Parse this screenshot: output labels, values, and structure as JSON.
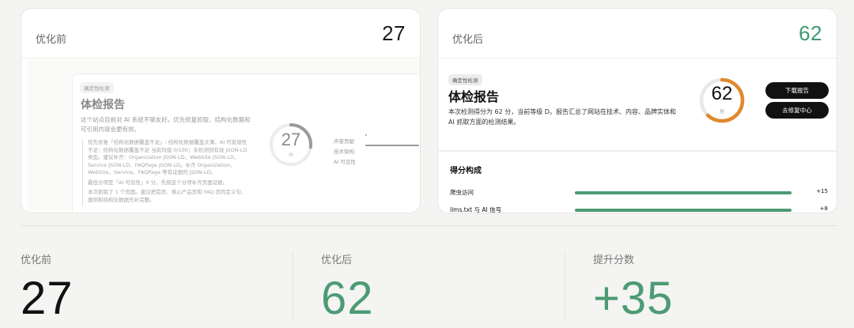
{
  "before_card": {
    "label": "优化前",
    "score": "27",
    "preview": {
      "badge": "确定性检测",
      "title": "体检报告",
      "description": "这个站点目前对 AI 系统不够友好。优先修复抓取、结构化数据和可引用内容会更有效。",
      "notes": [
        "优先修复「结构化数据覆盖不足」: 结构化数据覆盖太薄，AI 可发现性不足：结构化数据覆盖不足 当前均值 0/100；未检测到有效 JSON-LD 类型。建议补齐：Organization JSON-LD、WebSite JSON-LD、Service JSON-LD、FAQPage JSON-LD。补齐 Organization、WebSite、Service、FAQPage 等有证据的 JSON-LD。",
        "最低分项是「AI 可见性」0 分，先按这个分项补齐页面证据。",
        "本次抓取了 1 个页面。建议把首页、核心产品页和 FAQ 页的定义句、案例和结构化数据先补完整。"
      ],
      "gauge_value": 27,
      "gauge_unit": "分",
      "metrics": [
        {
          "label": "声誉贡献",
          "level": 0.02
        },
        {
          "label": "技术架构",
          "level": 0.85
        },
        {
          "label": "AI 可见性",
          "level": 0
        }
      ]
    }
  },
  "after_card": {
    "label": "优化后",
    "score": "62",
    "report": {
      "badge": "确定性检测",
      "title": "体检报告",
      "description": "本次检测得分为 62 分，当前等级 D。报告汇总了网站在技术、内容、品牌实体和 AI 抓取方面的检测结果。",
      "gauge_value": 62,
      "gauge_unit": "分",
      "gauge_color": "#e0892e",
      "download_label": "下载报告",
      "fix_label": "去修复中心"
    },
    "breakdown": {
      "title": "得分构成",
      "rows": [
        {
          "label": "爬虫访问",
          "value": "+15",
          "level": 1.0
        },
        {
          "label": "llms.txt 与 AI 信号",
          "value": "+8",
          "level": 1.0
        }
      ]
    }
  },
  "summary": {
    "before_label": "优化前",
    "before_value": "27",
    "after_label": "优化后",
    "after_value": "62",
    "gain_label": "提升分数",
    "gain_value": "+35"
  },
  "colors": {
    "green": "#4c9b74",
    "orange": "#e0892e",
    "dark": "#111111"
  }
}
